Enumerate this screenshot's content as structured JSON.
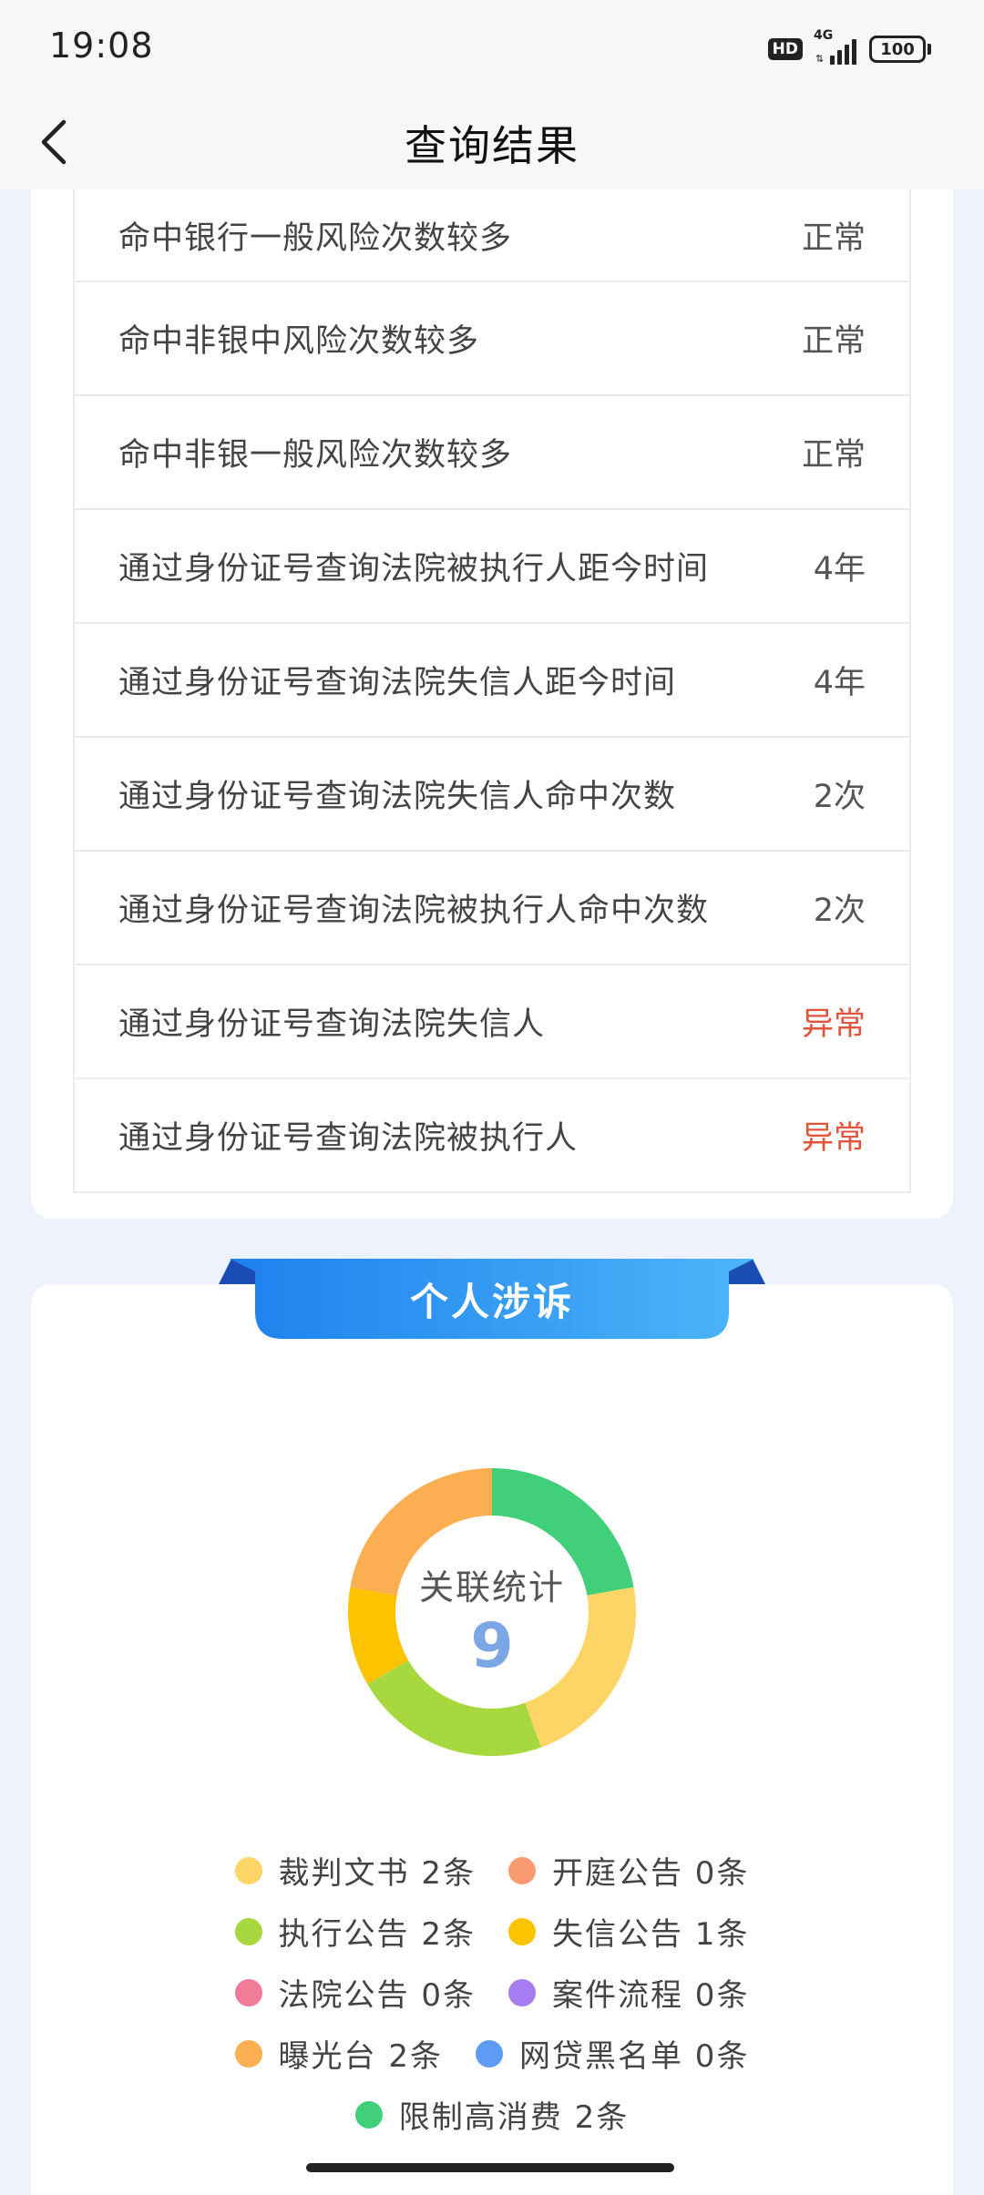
{
  "status_bar": {
    "time": "19:08",
    "hd": "HD",
    "network": "4G",
    "battery": "100"
  },
  "nav": {
    "title": "查询结果"
  },
  "results": [
    {
      "label": "命中银行一般风险次数较多",
      "value": "正常",
      "status": "normal"
    },
    {
      "label": "命中非银中风险次数较多",
      "value": "正常",
      "status": "normal"
    },
    {
      "label": "命中非银一般风险次数较多",
      "value": "正常",
      "status": "normal"
    },
    {
      "label": "通过身份证号查询法院被执行人距今时间",
      "value": "4年",
      "status": "normal"
    },
    {
      "label": "通过身份证号查询法院失信人距今时间",
      "value": "4年",
      "status": "normal"
    },
    {
      "label": "通过身份证号查询法院失信人命中次数",
      "value": "2次",
      "status": "normal"
    },
    {
      "label": "通过身份证号查询法院被执行人命中次数",
      "value": "2次",
      "status": "normal"
    },
    {
      "label": "通过身份证号查询法院失信人",
      "value": "异常",
      "status": "abnormal"
    },
    {
      "label": "通过身份证号查询法院被执行人",
      "value": "异常",
      "status": "abnormal"
    }
  ],
  "litigation": {
    "title": "个人涉诉",
    "center_label": "关联统计",
    "total": "9"
  },
  "colors": {
    "abnormal": "#E2553D",
    "ribbon_start": "#1E80EE",
    "ribbon_end": "#4DB5F8"
  },
  "chart_data": {
    "type": "pie",
    "categories": [
      "裁判文书",
      "开庭公告",
      "执行公告",
      "失信公告",
      "法院公告",
      "案件流程",
      "曝光台",
      "网贷黑名单",
      "限制高消费"
    ],
    "values": [
      2,
      0,
      2,
      1,
      0,
      0,
      2,
      0,
      2
    ],
    "colors": [
      "#FDD567",
      "#F89B72",
      "#A8D840",
      "#FCC300",
      "#F07C98",
      "#A57CF2",
      "#FBAE52",
      "#5E9BF4",
      "#42CF7A"
    ],
    "order": [
      8,
      0,
      2,
      3,
      6
    ],
    "total": 9
  },
  "legend": [
    [
      {
        "label": "裁判文书 2条",
        "color": "#FDD567"
      },
      {
        "label": "开庭公告 0条",
        "color": "#F89B72"
      }
    ],
    [
      {
        "label": "执行公告 2条",
        "color": "#A8D840"
      },
      {
        "label": "失信公告 1条",
        "color": "#FCC300"
      }
    ],
    [
      {
        "label": "法院公告 0条",
        "color": "#F07C98"
      },
      {
        "label": "案件流程 0条",
        "color": "#A57CF2"
      }
    ],
    [
      {
        "label": "曝光台 2条",
        "color": "#FBAE52"
      },
      {
        "label": "网贷黑名单 0条",
        "color": "#5E9BF4"
      }
    ],
    [
      {
        "label": "限制高消费 2条",
        "color": "#42CF7A"
      }
    ]
  ]
}
